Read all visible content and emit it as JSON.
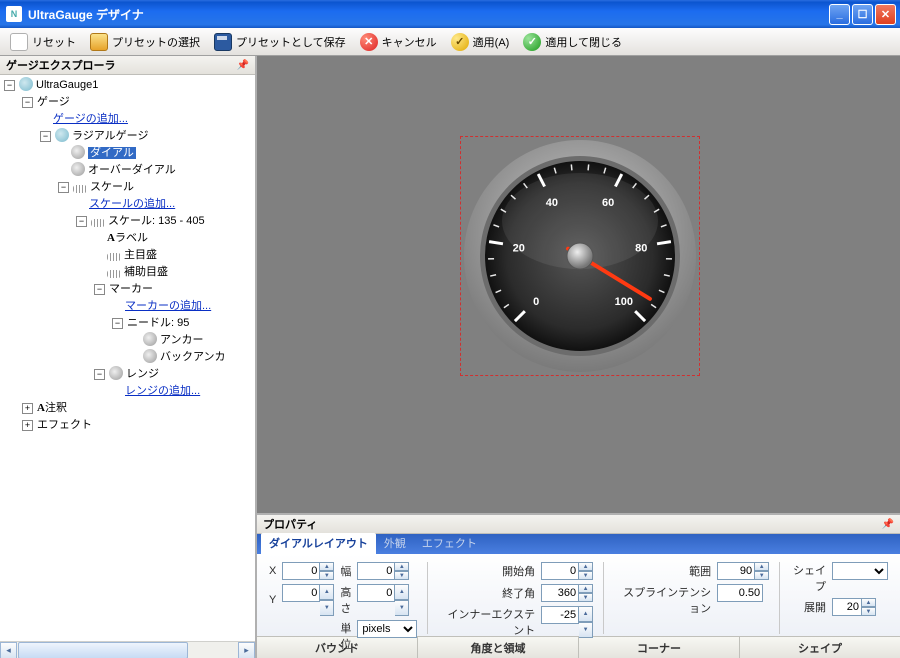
{
  "window": {
    "title": "UltraGauge デザイナ",
    "icon_text": "N"
  },
  "toolbar": {
    "reset": "リセット",
    "choose_preset": "プリセットの選択",
    "save_preset": "プリセットとして保存",
    "cancel": "キャンセル",
    "apply": "適用(A)",
    "apply_close": "適用して閉じる"
  },
  "explorer": {
    "title": "ゲージエクスプローラ",
    "root": "UltraGauge1",
    "gauges": "ゲージ",
    "add_gauge": "ゲージの追加...",
    "radial_gauge": "ラジアルゲージ",
    "dial": "ダイアル",
    "over_dial": "オーバーダイアル",
    "scales": "スケール",
    "add_scale": "スケールの追加...",
    "scale_item": "スケール: 135 - 405",
    "label": "ラベル",
    "major_tick": "主目盛",
    "minor_tick": "補助目盛",
    "markers": "マーカー",
    "add_marker": "マーカーの追加...",
    "needle": "ニードル: 95",
    "anchor": "アンカー",
    "back_anchor": "バックアンカ",
    "ranges": "レンジ",
    "add_range": "レンジの追加...",
    "annotations": "注釈",
    "effects": "エフェクト"
  },
  "properties": {
    "title": "プロパティ",
    "tabs": {
      "layout": "ダイアルレイアウト",
      "appearance": "外観",
      "effects": "エフェクト"
    },
    "x": "X",
    "x_v": "0",
    "y": "Y",
    "y_v": "0",
    "width": "幅",
    "width_v": "0",
    "height": "高さ",
    "height_v": "0",
    "unit": "単位",
    "unit_v": "pixels",
    "start_angle": "開始角",
    "start_angle_v": "0",
    "end_angle": "終了角",
    "end_angle_v": "360",
    "inner_extent": "インナーエクステント",
    "inner_extent_v": "-25",
    "range": "範囲",
    "range_v": "90",
    "spline": "スプラインテンション",
    "spline_v": "0.50",
    "shape": "シェイプ",
    "deploy": "展開",
    "deploy_v": "20",
    "groups": {
      "bound": "バウンド",
      "angle": "角度と領域",
      "corner": "コーナー",
      "shape": "シェイプ"
    }
  },
  "chart_data": {
    "type": "gauge",
    "title": "",
    "min": 0,
    "max": 100,
    "major_ticks": [
      0,
      20,
      40,
      60,
      80,
      100
    ],
    "needle_value": 95,
    "scale_start_angle": 135,
    "scale_end_angle": 405
  }
}
